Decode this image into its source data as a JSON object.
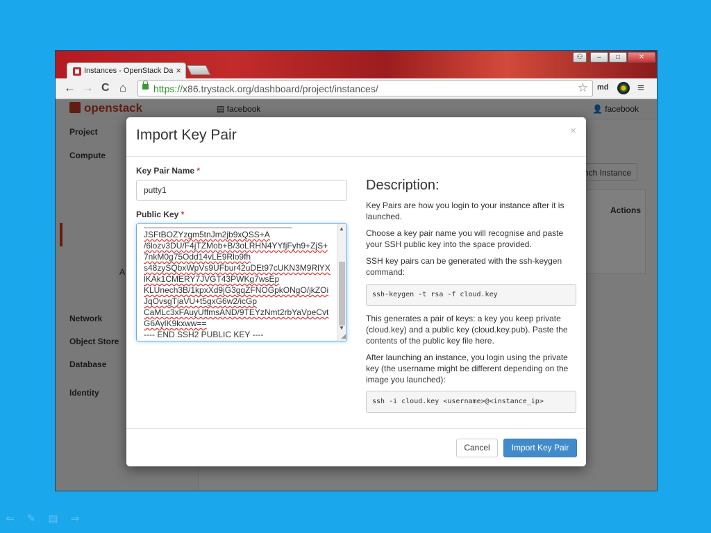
{
  "browser": {
    "tab_title": "Instances - OpenStack Da",
    "tab_close": "×",
    "url_scheme": "https://",
    "url_rest": "x86.trystack.org/dashboard/project/instances/",
    "nav_back": "←",
    "nav_forward": "→",
    "nav_reload": "C",
    "nav_home": "⌂",
    "bookmark_star": "☆",
    "ext_label": "md",
    "menu_glyph": "≡",
    "window_controls": {
      "min": "–",
      "max": "□",
      "close": "✕"
    }
  },
  "page": {
    "logo_text": "openstack",
    "project_selector": "facebook",
    "user_selector": "facebook",
    "sidebar": {
      "project": "Project",
      "compute": "Compute",
      "network": "Network",
      "object_store": "Object Store",
      "database": "Database",
      "identity": "Identity",
      "partial_text": "A"
    },
    "launch_button": "nch Instance",
    "table_header_actions": "Actions",
    "table_header_partial": [
      "e",
      "e",
      "ted"
    ]
  },
  "modal": {
    "title": "Import Key Pair",
    "close": "×",
    "key_pair_name_label": "Key Pair Name",
    "key_pair_name_value": "putty1",
    "public_key_label": "Public Key",
    "required_mark": "*",
    "public_key_lines": [
      "JSFtBOZYzgm5tnJm2jb9xQSS+A",
      "/6lozv3DU/F4jTZMob+B/3oLRHN4YYfjFyh9+ZjS+",
      "7nkM0g75Odd14vLE9Rlo9fh",
      "s48zySQbxWpVs9UFbur42uDEt97cUKN3M9RlYX",
      "lKAk1CMERY7JVGT43PWKg7wsEp",
      "KLUnech3B/1kpxXd9jG3gqZFNOGpkONgO/jkZOi",
      "JqOvsgTjaVU+t5gxG6w2/icGp",
      "CaMLc3xFAuyUffmsAND/9TEYzNmt2rbYaVpeCvt",
      "G6AylK9kxww==",
      "---- END SSH2 PUBLIC KEY ----"
    ],
    "description_title": "Description:",
    "desc_p1": "Key Pairs are how you login to your instance after it is launched.",
    "desc_p2": "Choose a key pair name you will recognise and paste your SSH public key into the space provided.",
    "desc_p3": "SSH key pairs can be generated with the ssh-keygen command:",
    "code1": "ssh-keygen -t rsa -f cloud.key",
    "desc_p4": "This generates a pair of keys: a key you keep private (cloud.key) and a public key (cloud.key.pub). Paste the contents of the public key file here.",
    "desc_p5": "After launching an instance, you login using the private key (the username might be different depending on the image you launched):",
    "code2": "ssh -i cloud.key <username>@<instance_ip>",
    "cancel_button": "Cancel",
    "import_button": "Import Key Pair"
  },
  "presentation": {
    "prev": "⇐",
    "pen": "✎",
    "menu": "▤",
    "next": "⇒"
  },
  "colors": {
    "desktop_bg": "#1aa7ec",
    "primary_button": "#428bca",
    "openstack_red": "#c23b21",
    "required": "#b94a48"
  }
}
